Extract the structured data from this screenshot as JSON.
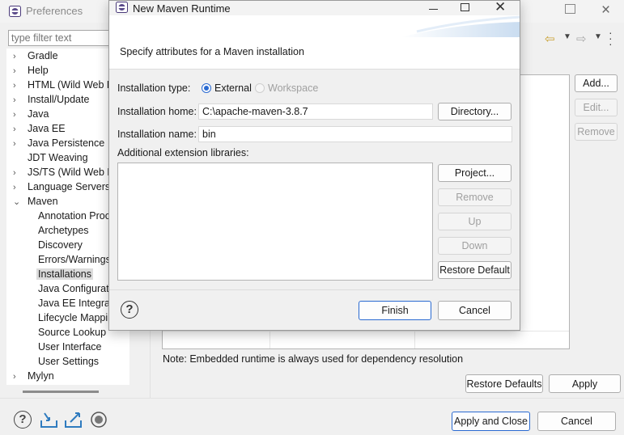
{
  "preferences": {
    "title": "Preferences",
    "filter_placeholder": "type filter text",
    "tree": [
      {
        "label": "Gradle",
        "arrow": "›",
        "indent": 0
      },
      {
        "label": "Help",
        "arrow": "›",
        "indent": 0
      },
      {
        "label": "HTML (Wild Web De",
        "arrow": "›",
        "indent": 0
      },
      {
        "label": "Install/Update",
        "arrow": "›",
        "indent": 0
      },
      {
        "label": "Java",
        "arrow": "›",
        "indent": 0
      },
      {
        "label": "Java EE",
        "arrow": "›",
        "indent": 0
      },
      {
        "label": "Java Persistence",
        "arrow": "›",
        "indent": 0
      },
      {
        "label": "JDT Weaving",
        "arrow": "",
        "indent": 0
      },
      {
        "label": "JS/TS (Wild Web De",
        "arrow": "›",
        "indent": 0
      },
      {
        "label": "Language Servers",
        "arrow": "›",
        "indent": 0
      },
      {
        "label": "Maven",
        "arrow": "⌄",
        "indent": 0
      },
      {
        "label": "Annotation Proce",
        "arrow": "",
        "indent": 1
      },
      {
        "label": "Archetypes",
        "arrow": "",
        "indent": 1
      },
      {
        "label": "Discovery",
        "arrow": "",
        "indent": 1
      },
      {
        "label": "Errors/Warnings",
        "arrow": "",
        "indent": 1
      },
      {
        "label": "Installations",
        "arrow": "",
        "indent": 1,
        "selected": true
      },
      {
        "label": "Java Configurator",
        "arrow": "",
        "indent": 1
      },
      {
        "label": "Java EE Integratio",
        "arrow": "",
        "indent": 1
      },
      {
        "label": "Lifecycle Mapping",
        "arrow": "",
        "indent": 1
      },
      {
        "label": "Source Lookup",
        "arrow": "",
        "indent": 1
      },
      {
        "label": "User Interface",
        "arrow": "",
        "indent": 1
      },
      {
        "label": "User Settings",
        "arrow": "",
        "indent": 1
      },
      {
        "label": "Mylyn",
        "arrow": "›",
        "indent": 0
      }
    ],
    "side_buttons": {
      "add": "Add...",
      "edit": "Edit...",
      "remove": "Remove"
    },
    "note": "Note: Embedded runtime is always used for dependency resolution",
    "restore_defaults": "Restore Defaults",
    "apply": "Apply",
    "apply_and_close": "Apply and Close",
    "cancel": "Cancel",
    "nav_icons": {
      "back": "back-arrow-icon",
      "forward": "forward-arrow-icon",
      "menu": "view-menu-icon"
    },
    "bottom_icons": [
      "help-icon",
      "import-icon",
      "export-icon",
      "record-icon"
    ]
  },
  "dialog": {
    "title": "New Maven Runtime",
    "message": "Specify attributes for a Maven installation",
    "installation_type_label": "Installation type:",
    "type_external": "External",
    "type_workspace": "Workspace",
    "installation_home_label": "Installation home:",
    "installation_home_value": "C:\\apache-maven-3.8.7",
    "installation_name_label": "Installation name:",
    "installation_name_value": "bin",
    "ext_libraries_label": "Additional extension libraries:",
    "buttons": {
      "directory": "Directory...",
      "project": "Project...",
      "remove": "Remove",
      "up": "Up",
      "down": "Down",
      "restore_default": "Restore Default",
      "finish": "Finish",
      "cancel": "Cancel"
    },
    "help": "?"
  }
}
